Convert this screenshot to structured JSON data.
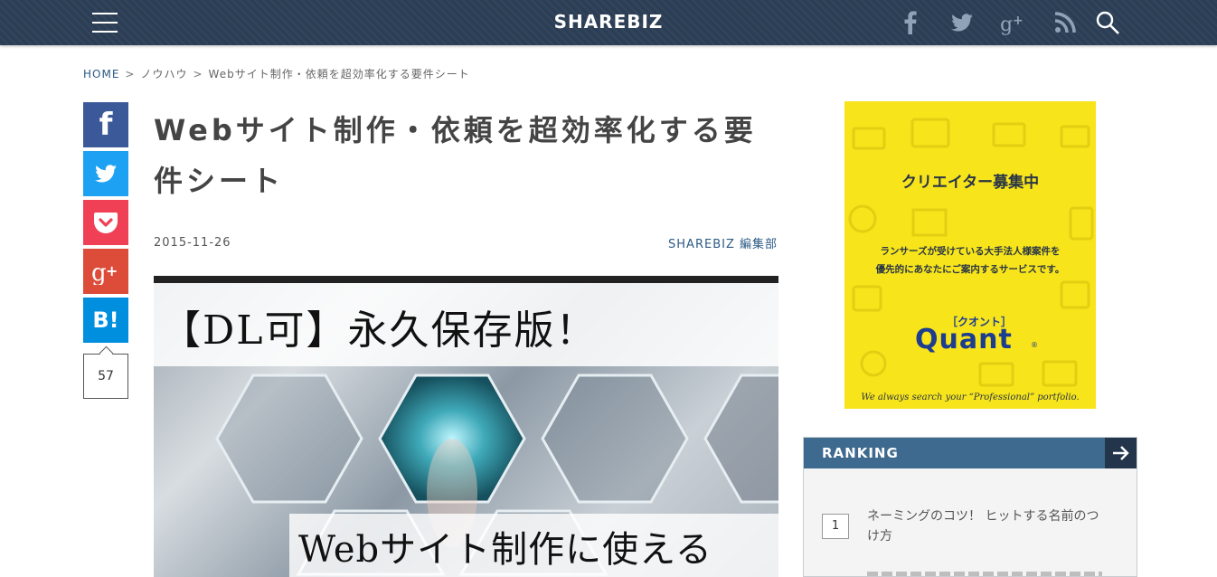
{
  "header": {
    "logo": "SHAREBIZ",
    "icons": [
      "facebook-icon",
      "twitter-icon",
      "google-plus-icon",
      "rss-icon",
      "search-icon"
    ]
  },
  "breadcrumb": {
    "home": "HOME",
    "separator": ">",
    "category": "ノウハウ",
    "current": "Webサイト制作・依頼を超効率化する要件シート"
  },
  "share": {
    "facebook": "f",
    "hatena": "B!",
    "count": "57"
  },
  "article": {
    "title": "Webサイト制作・依頼を超効率化する要件シート",
    "date": "2015-11-26",
    "author": "SHAREBIZ 編集部",
    "hero_caption_1": "【DL可】永久保存版！",
    "hero_caption_2": "Webサイト制作に使える"
  },
  "ad": {
    "title": "クリエイター募集中",
    "desc_line1": "ランサーズが受けている大手法人様案件を",
    "desc_line2": "優先的にあなたにご案内するサービスです。",
    "brand_kana": "［クオント］",
    "brand": "Quant",
    "registered": "®",
    "tagline": "We always search your “Professional” portfolio."
  },
  "ranking": {
    "title": "RANKING",
    "items": [
      {
        "rank": "1",
        "title": "ネーミングのコツ！ ヒットする名前のつけ方"
      }
    ]
  },
  "colors": {
    "header_bg": "#2c3e55",
    "accent_blue": "#2c5a85",
    "facebook": "#3b5998",
    "twitter": "#1da1f2",
    "pocket": "#ef4056",
    "google_plus": "#dd4b39",
    "hatena": "#008fde",
    "ad_yellow": "#f7e41b",
    "ranking_head": "#3d6a8e"
  }
}
